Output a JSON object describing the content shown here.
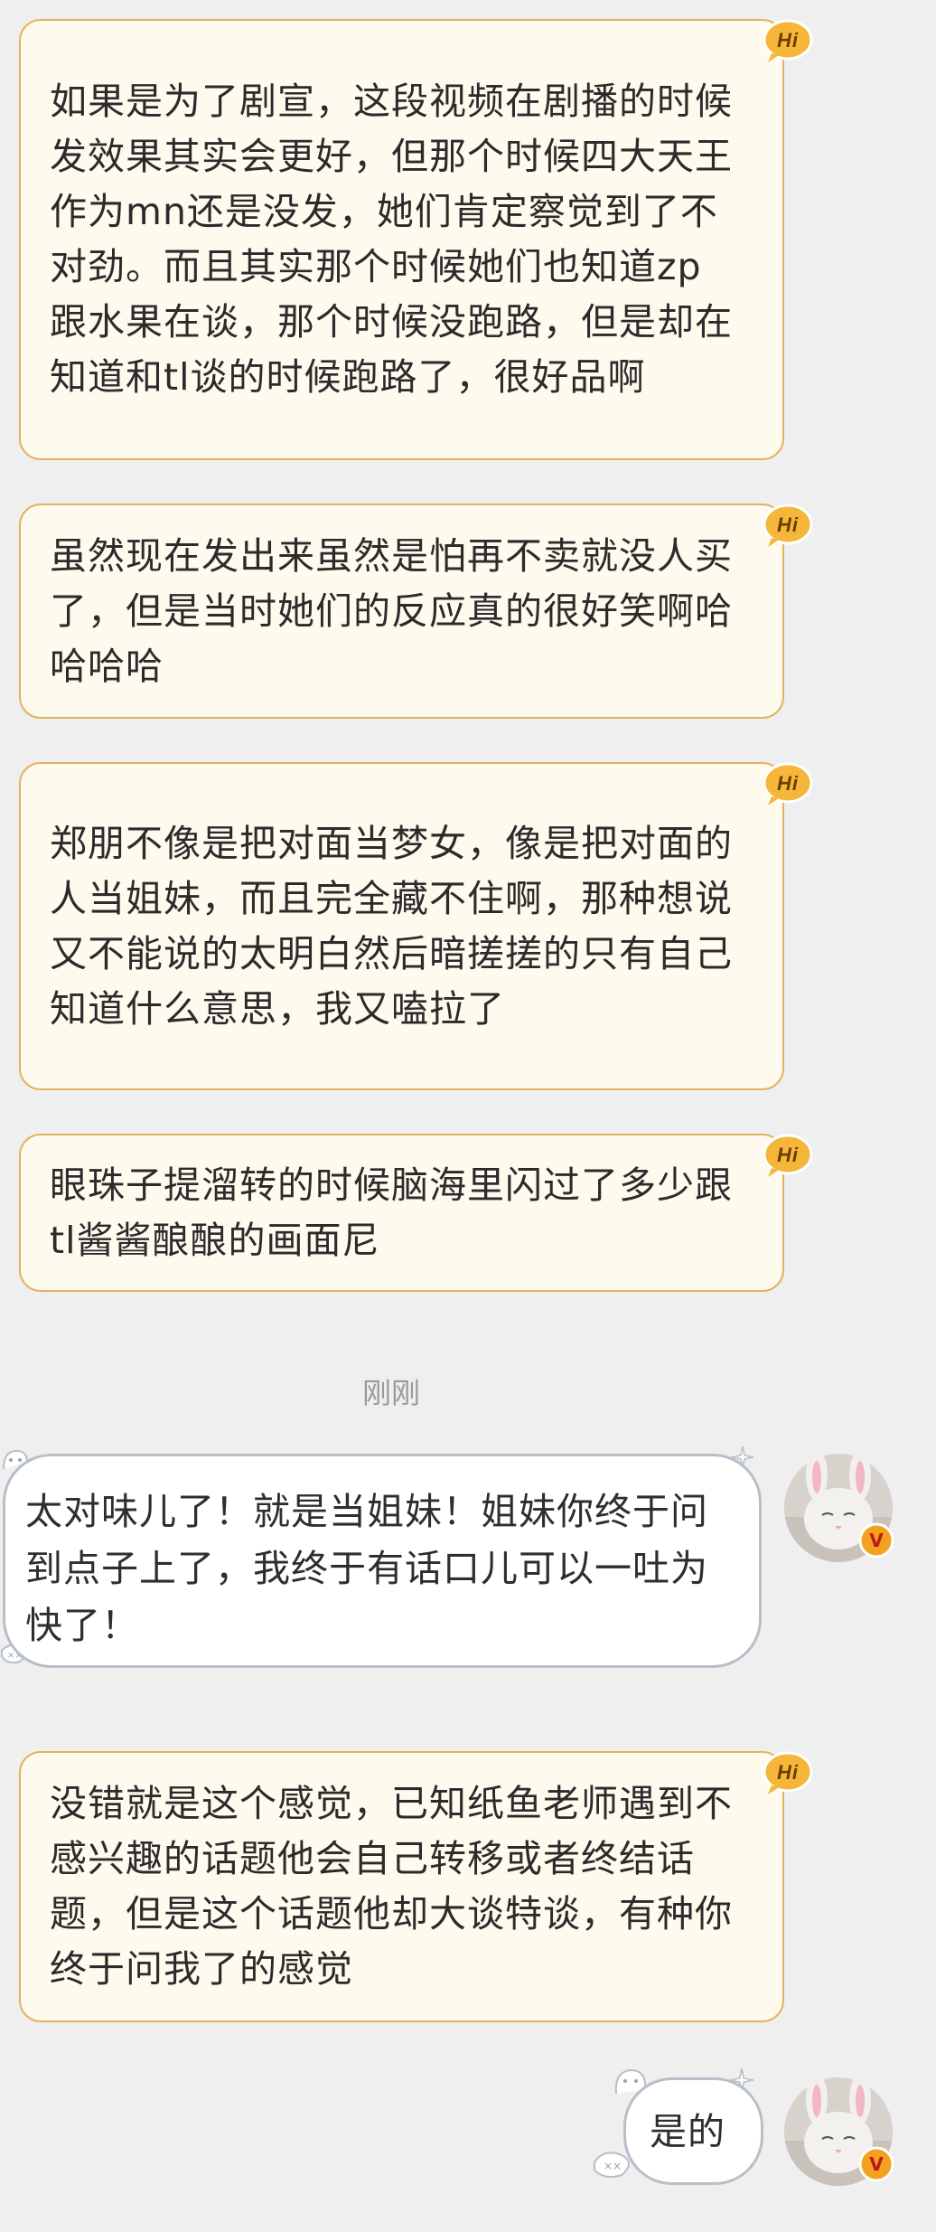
{
  "messages_in": [
    {
      "text": "如果是为了剧宣，这段视频在剧播的时候发效果其实会更好，但那个时候四大天王作为mn还是没发，她们肯定察觉到了不对劲。而且其实那个时候她们也知道zp跟水果在谈，那个时候没跑路，但是却在知道和tl谈的时候跑路了，很好品啊",
      "badge": "Hi"
    },
    {
      "text": "虽然现在发出来虽然是怕再不卖就没人买了，但是当时她们的反应真的很好笑啊哈哈哈哈",
      "badge": "Hi"
    },
    {
      "text": "郑朋不像是把对面当梦女，像是把对面的人当姐妹，而且完全藏不住啊，那种想说又不能说的太明白然后暗搓搓的只有自己知道什么意思，我又嗑拉了",
      "badge": "Hi"
    },
    {
      "text": "眼珠子提溜转的时候脑海里闪过了多少跟tl酱酱酿酿的画面尼",
      "badge": "Hi"
    },
    {
      "text": "没错就是这个感觉，已知纸鱼老师遇到不感兴趣的话题他会自己转移或者终结话题，但是这个话题他却大谈特谈，有种你终于问我了的感觉",
      "badge": "Hi"
    }
  ],
  "timestamp": "刚刚",
  "messages_out": [
    {
      "text": "太对味儿了！就是当姐妹！姐妹你终于问到点子上了，我终于有话口儿可以一吐为快了！"
    },
    {
      "text": "是的"
    }
  ],
  "colors": {
    "background": "#efefef",
    "incoming_bubble": "#fffaee",
    "incoming_border": "#e3b260",
    "outgoing_border": "#b7bfc9",
    "hi_badge": "#f5b63a",
    "verified_badge": "#f4a21d"
  },
  "icons": {
    "badge": "hi-badge-icon",
    "verified": "verified-v-icon",
    "avatar": "bunny-cat-avatar"
  }
}
